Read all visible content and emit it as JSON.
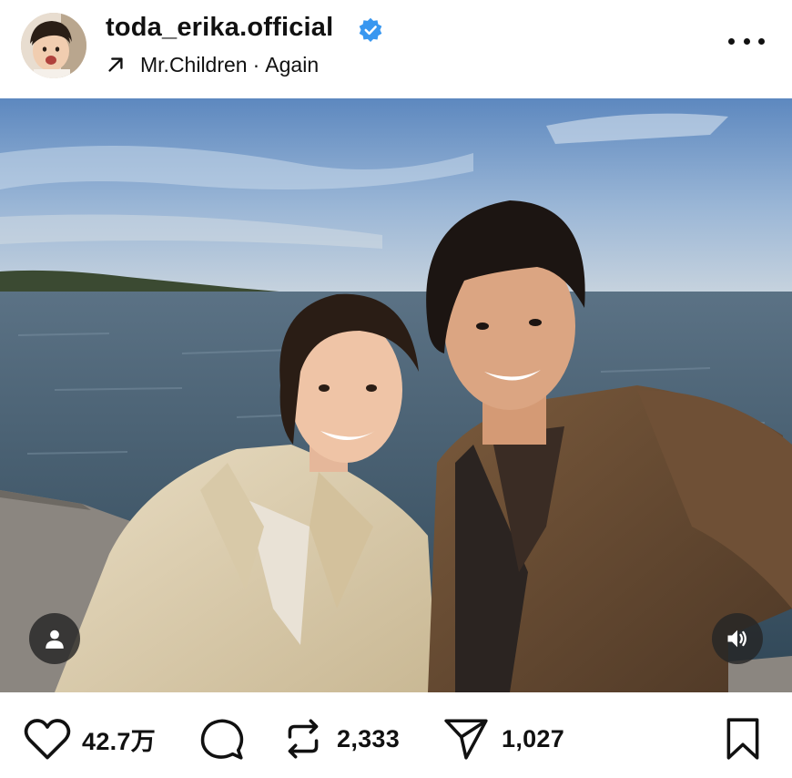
{
  "post": {
    "username": "toda_erika.official",
    "verified": true,
    "music": {
      "artist": "Mr.Children",
      "separator": "·",
      "song": "Again"
    }
  },
  "actions": {
    "likes": "42.7万",
    "reposts": "2,333",
    "shares": "1,027"
  },
  "icons": {
    "header": [
      "verified-badge-icon",
      "arrow-up-right-icon",
      "more-icon"
    ],
    "overlay": [
      "user-tag-icon",
      "volume-icon"
    ],
    "bar": [
      "heart-icon",
      "comment-icon",
      "repost-icon",
      "share-icon",
      "bookmark-icon"
    ]
  },
  "colors": {
    "verified": "#3897f0",
    "text": "#111111",
    "background": "#ffffff"
  }
}
